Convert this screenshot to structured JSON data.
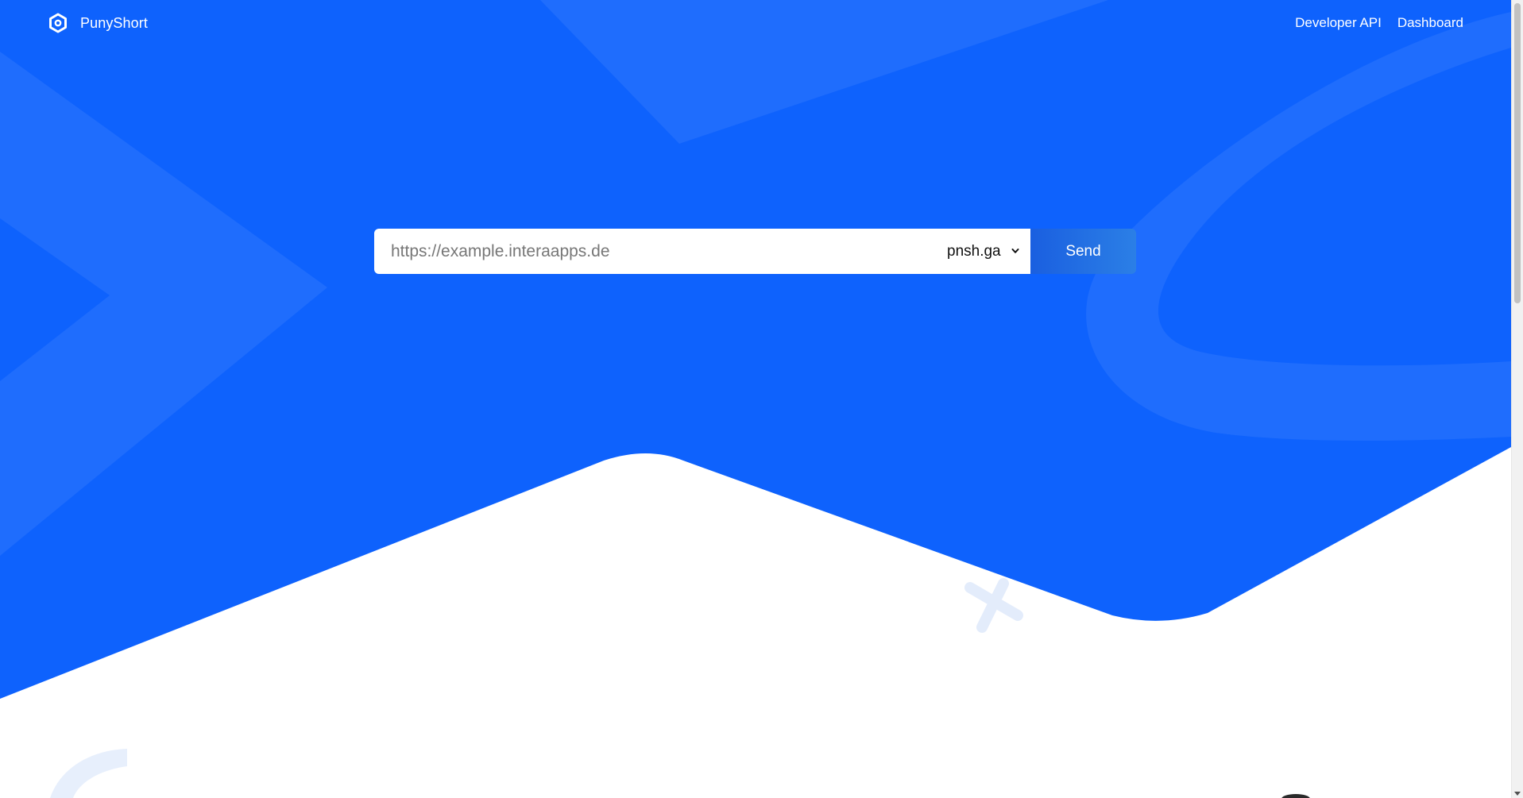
{
  "brand": {
    "name": "PunyShort"
  },
  "nav": {
    "links": [
      {
        "label": "Developer API"
      },
      {
        "label": "Dashboard"
      }
    ]
  },
  "form": {
    "url_placeholder": "https://example.interaapps.de",
    "url_value": "",
    "domain_selected": "pnsh.ga",
    "send_label": "Send"
  },
  "colors": {
    "hero_blue": "#0e62fd",
    "accent_gradient_start": "#1a5fe0",
    "accent_gradient_end": "#2b7fe6"
  },
  "icons": {
    "logo": "hexagon-logo-icon",
    "select_chevron": "chevron-down-icon"
  }
}
